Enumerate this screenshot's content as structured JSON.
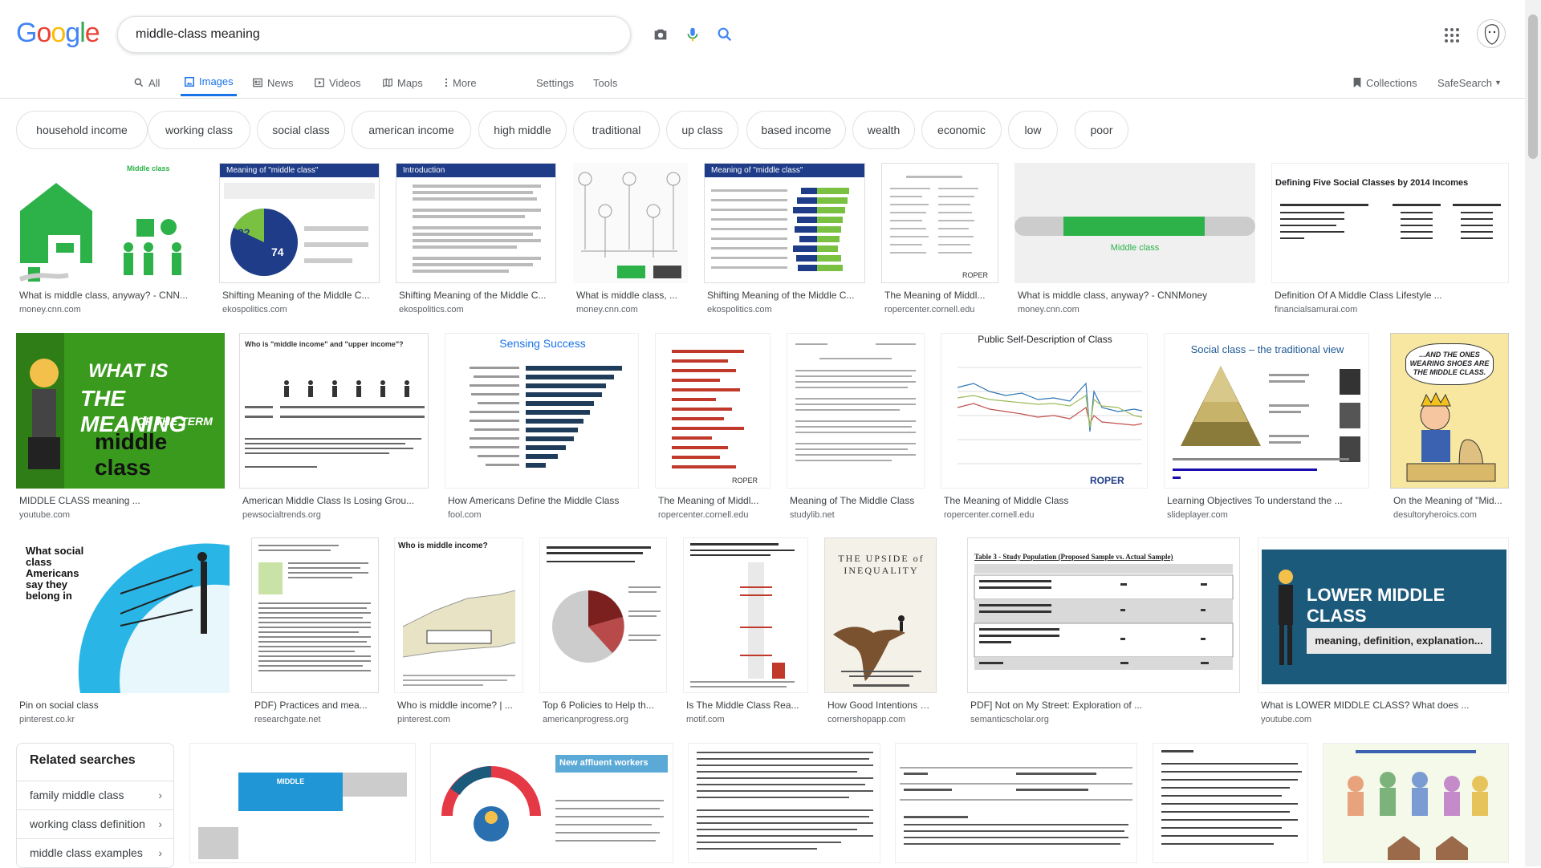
{
  "logo": {
    "letters": [
      "G",
      "o",
      "o",
      "g",
      "l",
      "e"
    ],
    "colors": [
      "#4285F4",
      "#EA4335",
      "#FBBC05",
      "#4285F4",
      "#34A853",
      "#EA4335"
    ]
  },
  "search": {
    "query": "middle-class meaning"
  },
  "icons": {
    "camera": "camera-icon",
    "mic": "microphone-icon",
    "search": "search-icon",
    "apps": "apps-grid-icon"
  },
  "tabs": [
    {
      "label": "All",
      "icon": "search-icon"
    },
    {
      "label": "Images",
      "icon": "image-icon"
    },
    {
      "label": "News",
      "icon": "news-icon"
    },
    {
      "label": "Videos",
      "icon": "video-icon"
    },
    {
      "label": "Maps",
      "icon": "map-icon"
    },
    {
      "label": "More",
      "icon": "more-icon"
    },
    {
      "label": "Settings"
    },
    {
      "label": "Tools"
    }
  ],
  "right_tabs": {
    "collections": "Collections",
    "safesearch": "SafeSearch"
  },
  "chips": [
    "household income",
    "working class",
    "social class",
    "american income",
    "high middle",
    "traditional",
    "up class",
    "based income",
    "wealth",
    "economic",
    "low",
    "poor"
  ],
  "results_row1": [
    {
      "title": "What is middle class, anyway? - CNN...",
      "source": "money.cnn.com",
      "heading": "Middle class"
    },
    {
      "title": "Shifting Meaning of the Middle C...",
      "source": "ekospolitics.com",
      "heading": "Meaning of \"middle class\"",
      "pie": [
        "22",
        "74"
      ]
    },
    {
      "title": "Shifting Meaning of the Middle C...",
      "source": "ekospolitics.com",
      "heading": "Introduction"
    },
    {
      "title": "What is middle class, ...",
      "source": "money.cnn.com"
    },
    {
      "title": "Shifting Meaning of the Middle C...",
      "source": "ekospolitics.com",
      "heading": "Meaning of \"middle class\""
    },
    {
      "title": "The Meaning of Middl...",
      "source": "ropercenter.cornell.edu"
    },
    {
      "title": "What is middle class, anyway? - CNNMoney",
      "source": "money.cnn.com",
      "bar_label": "Middle class"
    },
    {
      "title": "Definition Of A Middle Class Lifestyle ...",
      "source": "financialsamurai.com",
      "heading": "Defining Five Social Classes by 2014 Incomes"
    }
  ],
  "results_row2": [
    {
      "title": "MIDDLE CLASS meaning ...",
      "source": "youtube.com",
      "line1": "WHAT IS",
      "line2": "THE MEANING",
      "line3": "OF THE TERM",
      "line4": "middle class"
    },
    {
      "title": "American Middle Class Is Losing Grou...",
      "source": "pewsocialtrends.org",
      "heading": "Who is \"middle income\" and \"upper income\"?"
    },
    {
      "title": "How Americans Define the Middle Class",
      "source": "fool.com",
      "heading": "Sensing Success"
    },
    {
      "title": "The Meaning of Middl...",
      "source": "ropercenter.cornell.edu"
    },
    {
      "title": "Meaning of The Middle Class",
      "source": "studylib.net"
    },
    {
      "title": "The Meaning of Middle Class",
      "source": "ropercenter.cornell.edu",
      "heading": "Public Self-Description of Class"
    },
    {
      "title": "Learning Objectives To understand the ...",
      "source": "slideplayer.com",
      "heading": "Social class – the traditional view"
    },
    {
      "title": "On the Meaning of \"Mid...",
      "source": "desultoryheroics.com",
      "bubble": "...AND THE ONES WEARING SHOES ARE THE MIDDLE CLASS."
    }
  ],
  "results_row3": [
    {
      "title": "Pin on social class",
      "source": "pinterest.co.kr",
      "heading": "What social class Americans say they belong in"
    },
    {
      "title": "PDF) Practices and mea...",
      "source": "researchgate.net"
    },
    {
      "title": "Who is middle income? | ...",
      "source": "pinterest.com",
      "heading": "Who is middle income?"
    },
    {
      "title": "Top 6 Policies to Help th...",
      "source": "americanprogress.org"
    },
    {
      "title": "Is The Middle Class Rea...",
      "source": "motif.com"
    },
    {
      "title": "How Good Intentions Un...",
      "source": "cornershopapp.com",
      "book": "THE UPSIDE of INEQUALITY"
    },
    {
      "title": "PDF] Not on My Street: Exploration of ...",
      "source": "semanticscholar.org",
      "heading": "Table 3 - Study Population (Proposed Sample vs. Actual Sample)"
    },
    {
      "title": "What is LOWER MIDDLE CLASS? What does ...",
      "source": "youtube.com",
      "heading": "LOWER MIDDLE CLASS",
      "sub": "meaning, definition, explanation..."
    }
  ],
  "row4": [
    {
      "heading": "MIDDLE"
    },
    {
      "heading": "New affluent workers"
    },
    {},
    {},
    {},
    {}
  ],
  "related": {
    "title": "Related searches",
    "items": [
      "family middle class",
      "working class definition",
      "middle class examples"
    ]
  }
}
